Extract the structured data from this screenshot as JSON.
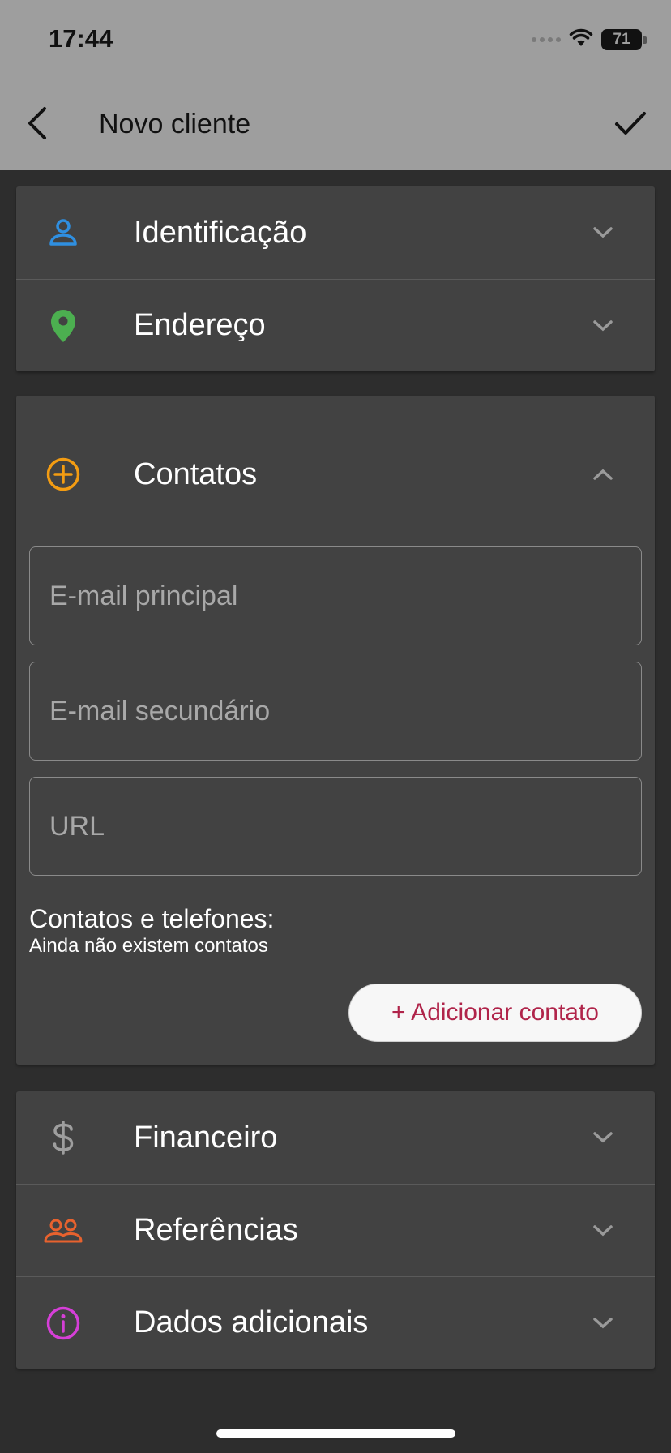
{
  "status": {
    "time": "17:44",
    "battery": "71"
  },
  "appbar": {
    "title": "Novo cliente"
  },
  "sections": {
    "identificacao": {
      "label": "Identificação",
      "icon": "person-icon",
      "color": "#2f8fe0"
    },
    "endereco": {
      "label": "Endereço",
      "icon": "location-pin-icon",
      "color": "#4caf50"
    },
    "contatos": {
      "label": "Contatos",
      "icon": "add-circle-icon",
      "color": "#f39c12"
    },
    "financeiro": {
      "label": "Financeiro",
      "icon": "dollar-icon",
      "color": "#9e9e9e"
    },
    "referencias": {
      "label": "Referências",
      "icon": "people-icon",
      "color": "#e8622e"
    },
    "dados_adicionais": {
      "label": "Dados adicionais",
      "icon": "info-icon",
      "color": "#d63fd8"
    }
  },
  "contatos_form": {
    "email_principal_placeholder": "E-mail principal",
    "email_secundario_placeholder": "E-mail secundário",
    "url_placeholder": "URL",
    "list_title": "Contatos e telefones:",
    "empty_text": "Ainda não existem contatos",
    "add_button_label": "+ Adicionar contato"
  },
  "colors": {
    "appbar_bg": "#9e9e9e",
    "card_bg": "#424242",
    "page_bg": "#2d2d2d",
    "accent": "#b0244a"
  }
}
